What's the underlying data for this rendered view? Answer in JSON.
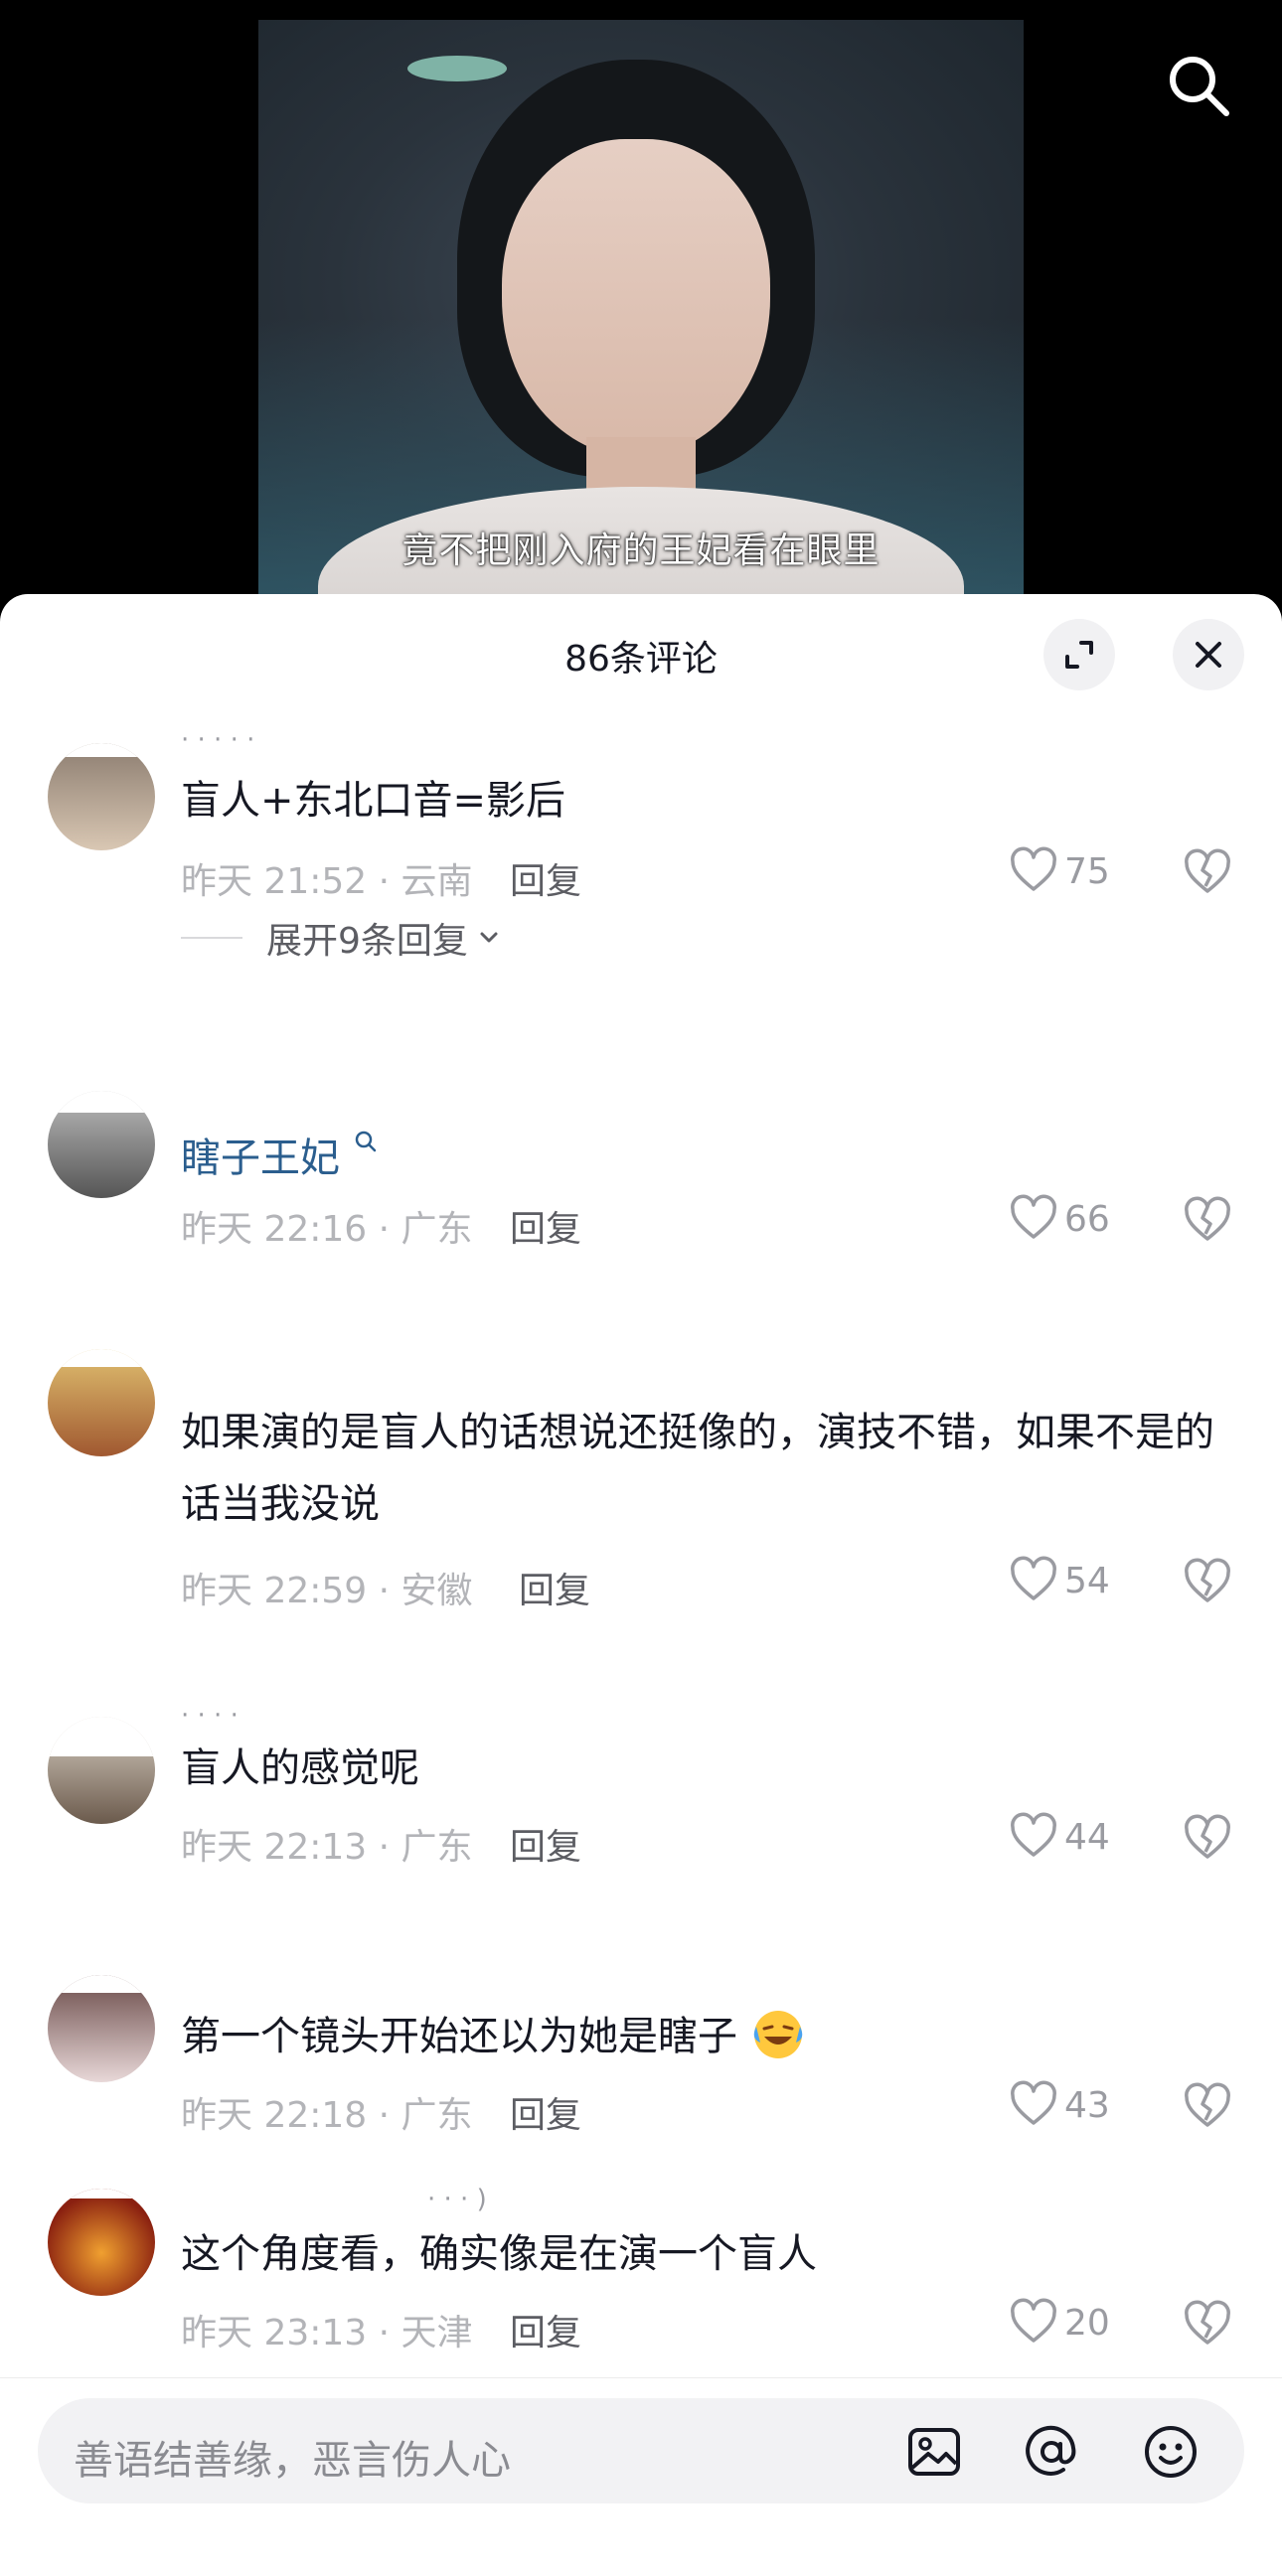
{
  "video": {
    "subtitle": "竟不把刚入府的王妃看在眼里"
  },
  "sheet": {
    "title": "86条评论"
  },
  "comments": [
    {
      "name_fragment": "· · · ·  ·",
      "text": "盲人+东北口音=影后",
      "meta": "昨天 21:52 · 云南",
      "reply": "回复",
      "likes": "75",
      "expand": "展开9条回复"
    },
    {
      "username": "瞎子王妃",
      "text": "",
      "meta": "昨天 22:16 · 广东",
      "reply": "回复",
      "likes": "66"
    },
    {
      "text": "如果演的是盲人的话想说还挺像的，演技不错，如果不是的话当我没说",
      "meta": "昨天 22:59 · 安徽",
      "reply": "回复",
      "likes": "54"
    },
    {
      "name_fragment": "· · · ·",
      "text": "盲人的感觉呢",
      "meta": "昨天 22:13 · 广东",
      "reply": "回复",
      "likes": "44"
    },
    {
      "text": "第一个镜头开始还以为她是瞎子",
      "meta": "昨天 22:18 · 广东",
      "reply": "回复",
      "likes": "43"
    },
    {
      "name_fragment": "· · · )",
      "text": "这个角度看，确实像是在演一个盲人",
      "meta": "昨天 23:13 · 天津",
      "reply": "回复",
      "likes": "20"
    }
  ],
  "input": {
    "placeholder": "善语结善缘，恶言伤人心"
  },
  "icons": [
    "search-icon",
    "expand-icon",
    "close-icon",
    "heart-icon",
    "broken-heart-icon",
    "image-icon",
    "at-icon",
    "emoji-icon",
    "chevron-down-icon",
    "search-small-icon"
  ]
}
